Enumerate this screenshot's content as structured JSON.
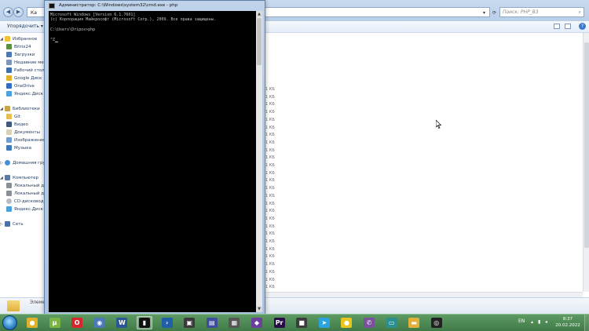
{
  "explorer": {
    "address_text": "Ка",
    "search_placeholder": "Поиск: PHP_B3",
    "organize_label": "Упорядочить",
    "nav": {
      "favorites": "Избранное",
      "favorites_items": [
        "Bitrix24",
        "Загрузки",
        "Недавние мес",
        "Рабочий стол",
        "Google Диск",
        "OneDrive",
        "Яндекс.Диск"
      ],
      "libraries": "Библиотеки",
      "libraries_items": [
        "Git",
        "Видео",
        "Документы",
        "Изображения",
        "Музыка"
      ],
      "homegroup": "Домашняя группа",
      "computer": "Компьютер",
      "computer_items": [
        "Локальный ди",
        "Локальный ди",
        "CD-дисковод",
        "Яндекс.Диск"
      ],
      "network": "Сеть"
    },
    "size_column": [
      "1 КБ",
      "1 КБ",
      "1 КБ",
      "1 КБ",
      "1 КБ",
      "1 КБ",
      "1 КБ",
      "1 КБ",
      "1 КБ",
      "1 КБ",
      "1 КБ",
      "1 КБ",
      "1 КБ",
      "1 КБ",
      "1 КБ",
      "1 КБ",
      "1 КБ",
      "1 КБ",
      "1 КБ",
      "1 КБ",
      "1 КБ",
      "1 КБ",
      "1 КБ",
      "1 КБ",
      "1 КБ",
      "1 КБ",
      "1 КБ"
    ],
    "details_name": "Элемен"
  },
  "cmd": {
    "title": "Администратор: C:\\Windows\\system32\\cmd.exe - php",
    "lines": [
      "Microsoft Windows [Version 6.1.7601]",
      "(c) Корпорация Майкрософт (Microsoft Corp.), 2009. Все права защищены.",
      "",
      "C:\\Users\\Dripos>php",
      "",
      "^Z"
    ]
  },
  "taskbar": {
    "apps": [
      {
        "name": "chrome",
        "glyph": "●",
        "color": "#e0b22b",
        "active": false
      },
      {
        "name": "torrent",
        "glyph": "µ",
        "color": "#7bb344",
        "active": false
      },
      {
        "name": "opera",
        "glyph": "O",
        "color": "#d8262e",
        "active": false
      },
      {
        "name": "finder",
        "glyph": "◉",
        "color": "#4a78b8",
        "active": false
      },
      {
        "name": "word",
        "glyph": "W",
        "color": "#2b5797",
        "active": false
      },
      {
        "name": "cmd",
        "glyph": "▮",
        "color": "#111111",
        "active": true
      },
      {
        "name": "powershell",
        "glyph": "›",
        "color": "#1f5fa8",
        "active": false
      },
      {
        "name": "terminal",
        "glyph": "▣",
        "color": "#3a3a3a",
        "active": false
      },
      {
        "name": "save",
        "glyph": "▤",
        "color": "#3b4d9c",
        "active": false
      },
      {
        "name": "video",
        "glyph": "▦",
        "color": "#555555",
        "active": false
      },
      {
        "name": "visualstudio",
        "glyph": "◆",
        "color": "#6a3fa0",
        "active": false
      },
      {
        "name": "premiere",
        "glyph": "Pr",
        "color": "#2a0d47",
        "active": false
      },
      {
        "name": "media",
        "glyph": "■",
        "color": "#3c3c3c",
        "active": false
      },
      {
        "name": "telegram",
        "glyph": "➤",
        "color": "#2aa3de",
        "active": false
      },
      {
        "name": "yellow",
        "glyph": "●",
        "color": "#e8c41e",
        "active": false
      },
      {
        "name": "viber",
        "glyph": "✆",
        "color": "#7b519d",
        "active": false
      },
      {
        "name": "remote",
        "glyph": "▭",
        "color": "#2c8f8f",
        "active": false
      },
      {
        "name": "folder",
        "glyph": "▬",
        "color": "#e2b13c",
        "active": false
      },
      {
        "name": "obs",
        "glyph": "◎",
        "color": "#222222",
        "active": false
      }
    ],
    "lang": "EN",
    "time": "8:37",
    "date": "20.02.2022"
  }
}
